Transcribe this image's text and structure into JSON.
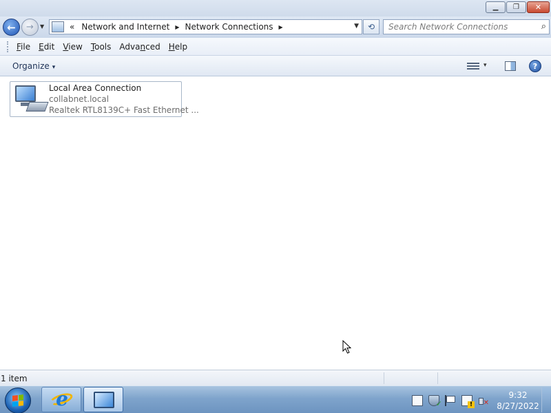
{
  "window": {
    "minimize_glyph": "▁",
    "maximize_glyph": "❐",
    "close_glyph": "✕"
  },
  "navbar": {
    "back_glyph": "←",
    "forward_glyph": "→",
    "recent_glyph": "▼",
    "address_prefix": "«",
    "breadcrumb": [
      "Network and Internet",
      "Network Connections"
    ],
    "separator_glyph": "▶",
    "address_dropdown_glyph": "▼",
    "refresh_glyph": "⟲",
    "search_placeholder": "Search Network Connections",
    "search_icon": "⌕"
  },
  "menu": {
    "items": [
      {
        "accel": "F",
        "rest": "ile"
      },
      {
        "accel": "E",
        "rest": "dit"
      },
      {
        "accel": "V",
        "rest": "iew"
      },
      {
        "accel": "T",
        "rest": "ools"
      },
      {
        "pre": "Adva",
        "accel": "n",
        "rest": "ced"
      },
      {
        "accel": "H",
        "rest": "elp"
      }
    ]
  },
  "commandbar": {
    "organize_label": "Organize",
    "caret_glyph": "▾",
    "help_glyph": "?"
  },
  "connection": {
    "name": "Local Area Connection",
    "domain": "collabnet.local",
    "device": "Realtek RTL8139C+ Fast Ethernet ..."
  },
  "status": {
    "item_count": "1 item"
  },
  "taskbar": {
    "time": "9:32",
    "date": "8/27/2022",
    "ie_glyph": "e"
  },
  "colors": {
    "accent": "#1d79d6",
    "close_button": "#c84a31",
    "taskbar": "#7fa4cc"
  }
}
